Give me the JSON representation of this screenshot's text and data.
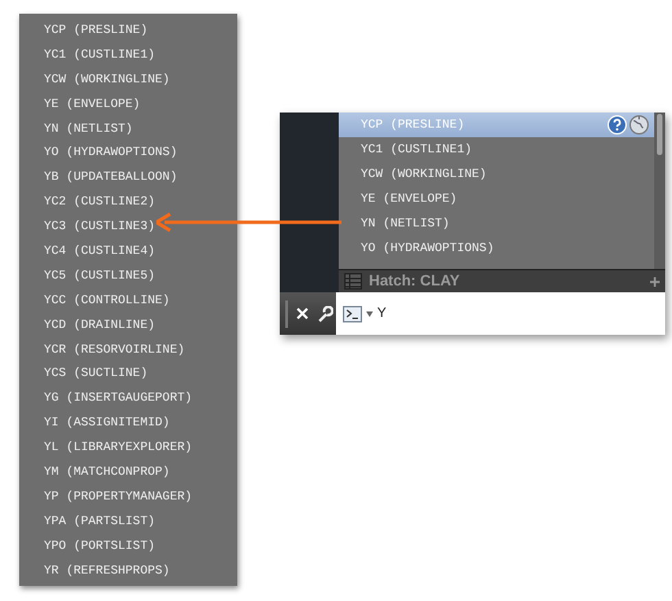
{
  "command_list": [
    "YCP (PRESLINE)",
    "YC1 (CUSTLINE1)",
    "YCW (WORKINGLINE)",
    "YE (ENVELOPE)",
    "YN (NETLIST)",
    "YO (HYDRAWOPTIONS)",
    "YB (UPDATEBALLOON)",
    "YC2 (CUSTLINE2)",
    "YC3 (CUSTLINE3)",
    "YC4 (CUSTLINE4)",
    "YC5 (CUSTLINE5)",
    "YCC (CONTROLLINE)",
    "YCD (DRAINLINE)",
    "YCR (RESORVOIRLINE)",
    "YCS (SUCTLINE)",
    "YG (INSERTGAUGEPORT)",
    "YI (ASSIGNITEMID)",
    "YL (LIBRARYEXPLORER)",
    "YM (MATCHCONPROP)",
    "YP (PROPERTYMANAGER)",
    "YPA (PARTSLIST)",
    "YPO (PORTSLIST)",
    "YR (REFRESHPROPS)"
  ],
  "autocomplete": {
    "items": [
      {
        "label": "YCP (PRESLINE)",
        "selected": true
      },
      {
        "label": "YC1 (CUSTLINE1)",
        "selected": false
      },
      {
        "label": "YCW (WORKINGLINE)",
        "selected": false
      },
      {
        "label": "YE (ENVELOPE)",
        "selected": false
      },
      {
        "label": "YN (NETLIST)",
        "selected": false
      },
      {
        "label": "YO (HYDRAWOPTIONS)",
        "selected": false
      }
    ]
  },
  "status": {
    "label": "Hatch: CLAY"
  },
  "command_line": {
    "value": "Y"
  }
}
